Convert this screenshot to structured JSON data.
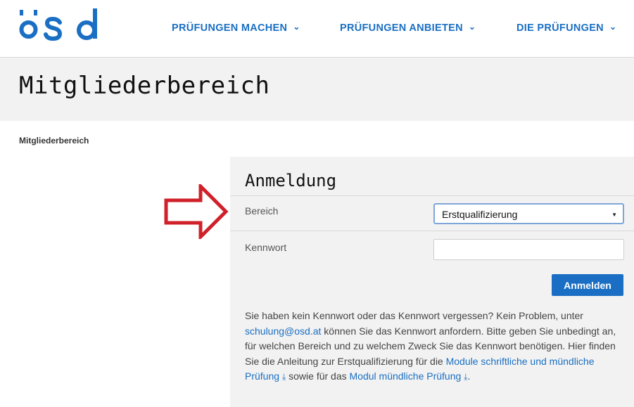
{
  "header": {
    "logo_alt": "ösd",
    "nav": [
      {
        "label": "PRÜFUNGEN MACHEN"
      },
      {
        "label": "PRÜFUNGEN ANBIETEN"
      },
      {
        "label": "DIE PRÜFUNGEN"
      }
    ],
    "brand_color": "#1a6fc4"
  },
  "page": {
    "title": "Mitgliederbereich",
    "breadcrumb": "Mitgliederbereich"
  },
  "login": {
    "title": "Anmeldung",
    "area_label": "Bereich",
    "area_value": "Erstqualifizierung",
    "password_label": "Kennwort",
    "password_value": "",
    "submit_label": "Anmelden",
    "help": {
      "text1": "Sie haben kein Kennwort oder das Kennwort vergessen? Kein Problem, unter ",
      "email_link": "schulung@osd.at",
      "text2": " können Sie das Kennwort anfordern. Bitte geben Sie unbedingt an, für welchen Bereich und zu welchem Zweck Sie das Kennwort benötigen. Hier finden Sie die Anleitung zur Erstqualifizierung für die ",
      "link1": "Module schriftliche und mündliche Prüfung",
      "text3": " sowie für das ",
      "link2": "Modul mündliche Prüfung",
      "text4": "."
    }
  },
  "annotation": {
    "arrow_color": "#d0202a"
  }
}
